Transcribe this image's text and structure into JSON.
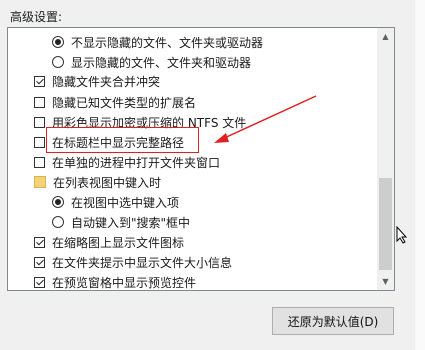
{
  "section_label": "高级设置:",
  "options": [
    {
      "kind": "radio",
      "checked": true,
      "label": "不显示隐藏的文件、文件夹或驱动器"
    },
    {
      "kind": "radio",
      "checked": false,
      "label": "显示隐藏的文件、文件夹和驱动器"
    },
    {
      "kind": "checkbox",
      "checked": true,
      "label": "隐藏文件夹合并冲突"
    },
    {
      "kind": "checkbox",
      "checked": false,
      "label": "隐藏已知文件类型的扩展名"
    },
    {
      "kind": "checkbox",
      "checked": false,
      "label": "用彩色显示加密或压缩的 NTFS 文件"
    },
    {
      "kind": "checkbox",
      "checked": false,
      "label": "在标题栏中显示完整路径"
    },
    {
      "kind": "checkbox",
      "checked": false,
      "label": "在单独的进程中打开文件夹窗口"
    },
    {
      "kind": "folder",
      "checked": false,
      "label": "在列表视图中键入时"
    },
    {
      "kind": "radio",
      "checked": true,
      "label": "在视图中选中键入项"
    },
    {
      "kind": "radio",
      "checked": false,
      "label": "自动键入到\"搜索\"框中"
    },
    {
      "kind": "checkbox",
      "checked": true,
      "label": "在缩略图上显示文件图标"
    },
    {
      "kind": "checkbox",
      "checked": true,
      "label": "在文件夹提示中显示文件大小信息"
    },
    {
      "kind": "checkbox",
      "checked": true,
      "label": "在预览窗格中显示预览控件"
    }
  ],
  "restore_button": "还原为默认值(D)",
  "colors": {
    "annotation": "#e02020"
  }
}
